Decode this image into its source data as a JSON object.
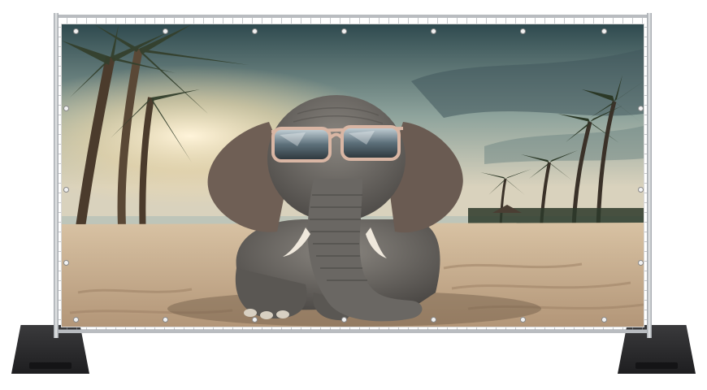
{
  "image": {
    "subject": "elephant-with-sunglasses-on-beach-banner",
    "palette": {
      "sky_top": "#3f5a5c",
      "sky_mid": "#9fb0a8",
      "sun_glow": "#f6e6c4",
      "sand": "#cdb395",
      "sand_shadow": "#8c7560",
      "elephant": "#6f6c68",
      "elephant_dark": "#3d3b39",
      "palm": "#2f3b2a",
      "trunk": "#5a4a3a",
      "frame": "#b9bcc0",
      "foot": "#2a2a2c"
    }
  }
}
